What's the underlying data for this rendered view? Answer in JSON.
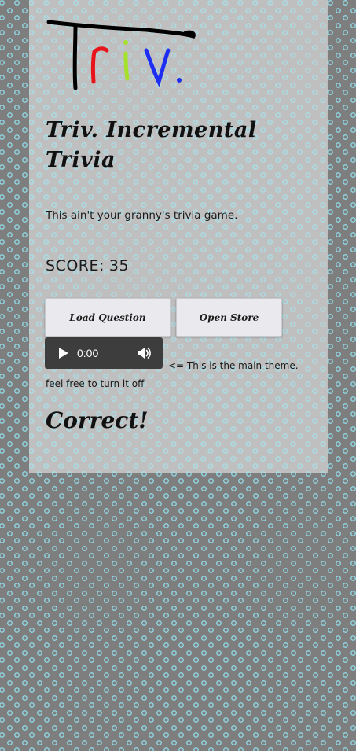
{
  "logo": {
    "text": "Triv.",
    "icon": "triv-logo-icon",
    "colors": {
      "T": "#000000",
      "r": "#e8141b",
      "i": "#a5e02a",
      "v": "#1d2ef2",
      "dot": "#1d2ef2"
    }
  },
  "page": {
    "title": "Triv. Incremental Trivia",
    "tagline": "This ain't your granny's trivia game."
  },
  "score": {
    "label": "SCORE:",
    "value": "35"
  },
  "buttons": {
    "load_question": "Load Question",
    "open_store": "Open Store"
  },
  "audio": {
    "time": "0:00",
    "play_icon": "play-icon",
    "volume_icon": "volume-icon"
  },
  "theme_note": {
    "line1": "<= This is the main theme.",
    "line2": "feel free to turn it off"
  },
  "result": {
    "text": "Correct!"
  },
  "colors": {
    "page_background": "#7e7e7e",
    "dot_pattern": "#8fd6e2",
    "panel": "#c8c8c8",
    "button_face": "#eaeaee",
    "audio_player": "#3d3d3d"
  }
}
